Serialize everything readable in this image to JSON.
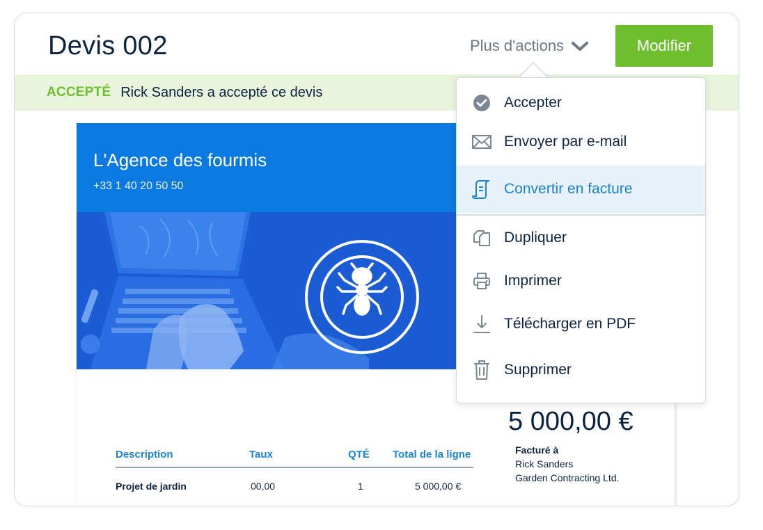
{
  "header": {
    "title": "Devis 002",
    "more_actions_label": "Plus d'actions",
    "edit_label": "Modifier"
  },
  "banner": {
    "status": "ACCEPTÉ",
    "message": "Rick Sanders a accepté ce devis"
  },
  "document": {
    "company": "L'Agence des fourmis",
    "phone": "+33 1 40 20 50 50",
    "amount": "5 000,00 €",
    "billed_to_label": "Facturé à",
    "billed_to_name": "Rick Sanders",
    "billed_to_company": "Garden Contracting Ltd.",
    "table": {
      "headers": [
        "Description",
        "Taux",
        "QTÉ",
        "Total de la ligne"
      ],
      "rows": [
        [
          "Projet de jardin",
          "00,00",
          "1",
          "5 000,00 €"
        ]
      ]
    }
  },
  "menu": {
    "items": [
      {
        "label": "Accepter",
        "icon": "check-circle-icon"
      },
      {
        "label": "Envoyer par e-mail",
        "icon": "envelope-icon"
      },
      {
        "label": "Convertir en facture",
        "icon": "invoice-convert-icon"
      },
      {
        "label": "Dupliquer",
        "icon": "duplicate-icon"
      },
      {
        "label": "Imprimer",
        "icon": "printer-icon"
      },
      {
        "label": "Télécharger en PDF",
        "icon": "download-icon"
      },
      {
        "label": "Supprimer",
        "icon": "trash-icon"
      }
    ]
  },
  "colors": {
    "accent_green": "#6ebe2e",
    "header_blue": "#0a7ae0",
    "link_blue": "#1a83d6",
    "banner_bg": "#e9f4dc",
    "active_item_bg": "#e7f2fb"
  }
}
